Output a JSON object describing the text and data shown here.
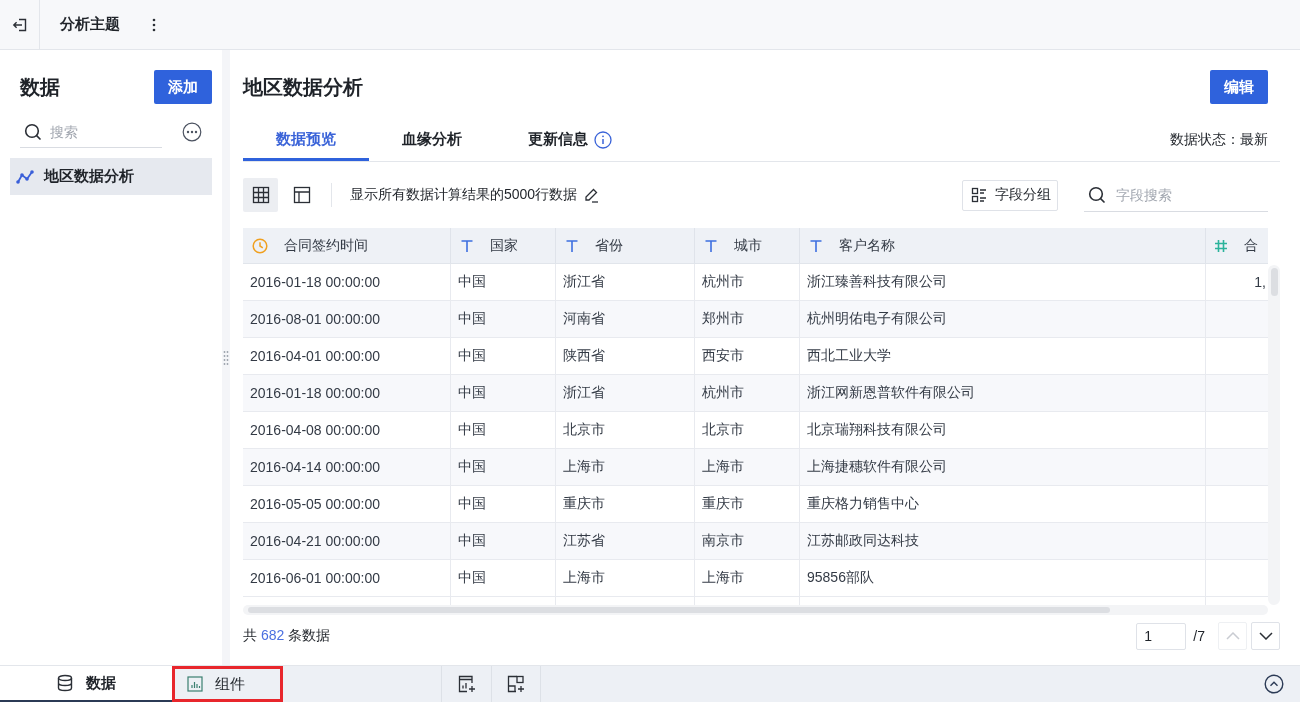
{
  "top_bar": {
    "title": "分析主题"
  },
  "sidebar": {
    "title": "数据",
    "add_button": "添加",
    "search": {
      "placeholder": "搜索"
    },
    "items": [
      {
        "label": "地区数据分析",
        "selected": true
      }
    ]
  },
  "main": {
    "title": "地区数据分析",
    "edit_button": "编辑",
    "tabs": [
      {
        "label": "数据预览",
        "selected": true,
        "info": false
      },
      {
        "label": "血缘分析",
        "selected": false,
        "info": false
      },
      {
        "label": "更新信息",
        "selected": false,
        "info": true
      }
    ],
    "data_status": "数据状态：最新"
  },
  "toolbar": {
    "views": [
      {
        "kind": "grid",
        "selected": true
      },
      {
        "kind": "layout",
        "selected": false
      }
    ],
    "note": "显示所有数据计算结果的5000行数据",
    "group_button": "字段分组",
    "search": {
      "placeholder": "字段搜索"
    }
  },
  "table": {
    "columns": [
      {
        "label": "合同签约时间",
        "kind": "date"
      },
      {
        "label": "国家",
        "kind": "text"
      },
      {
        "label": "省份",
        "kind": "text"
      },
      {
        "label": "城市",
        "kind": "text"
      },
      {
        "label": "客户名称",
        "kind": "text"
      },
      {
        "label": "合",
        "kind": "number"
      }
    ],
    "rows": [
      [
        "2016-01-18 00:00:00",
        "中国",
        "浙江省",
        "杭州市",
        "浙江臻善科技有限公司",
        "1,"
      ],
      [
        "2016-08-01 00:00:00",
        "中国",
        "河南省",
        "郑州市",
        "杭州明佑电子有限公司"
      ],
      [
        "2016-04-01 00:00:00",
        "中国",
        "陕西省",
        "西安市",
        "西北工业大学"
      ],
      [
        "2016-01-18 00:00:00",
        "中国",
        "浙江省",
        "杭州市",
        "浙江网新恩普软件有限公司"
      ],
      [
        "2016-04-08 00:00:00",
        "中国",
        "北京市",
        "北京市",
        "北京瑞翔科技有限公司"
      ],
      [
        "2016-04-14 00:00:00",
        "中国",
        "上海市",
        "上海市",
        "上海捷穗软件有限公司"
      ],
      [
        "2016-05-05 00:00:00",
        "中国",
        "重庆市",
        "重庆市",
        "重庆格力销售中心"
      ],
      [
        "2016-04-21 00:00:00",
        "中国",
        "江苏省",
        "南京市",
        "江苏邮政同达科技"
      ],
      [
        "2016-06-01 00:00:00",
        "中国",
        "上海市",
        "上海市",
        "95856部队"
      ]
    ]
  },
  "footer": {
    "total": {
      "prefix": "共",
      "count": "682",
      "suffix": "条数据"
    },
    "pagination": {
      "page": "1",
      "total": "/7",
      "prev_disabled": true,
      "next_disabled": false
    }
  },
  "bottom_bar": {
    "tabs": [
      {
        "label": "数据",
        "kind": "data",
        "selected": true,
        "highlighted": false
      },
      {
        "label": "组件",
        "kind": "widget",
        "selected": false,
        "highlighted": true
      }
    ]
  }
}
